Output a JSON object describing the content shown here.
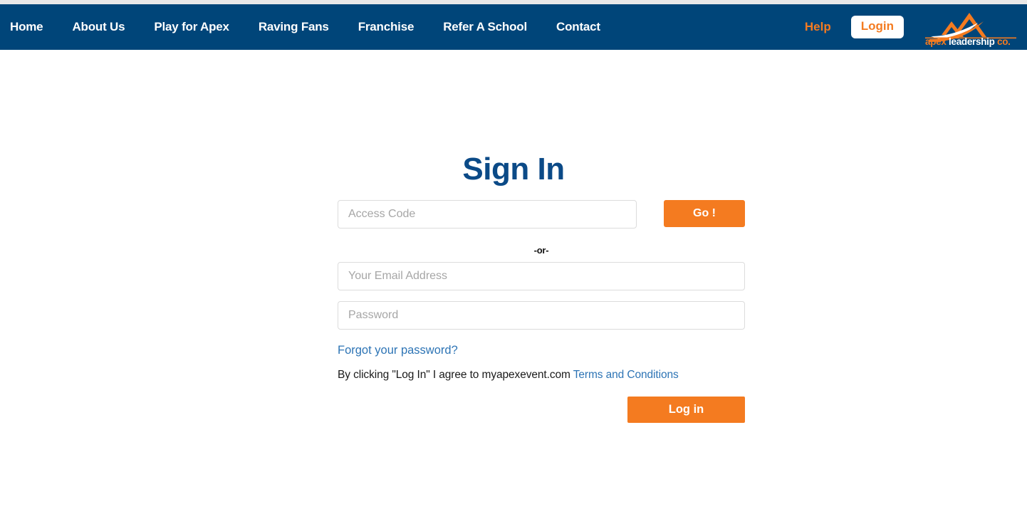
{
  "brand": {
    "logo_text_part1": "apex ",
    "logo_text_part2": "leadership ",
    "logo_text_part3": "co.",
    "navy": "#004579",
    "orange": "#f47b20",
    "link_blue": "#2d74b5",
    "heading_blue": "#0b4a87"
  },
  "nav": {
    "items": [
      {
        "label": "Home"
      },
      {
        "label": "About Us"
      },
      {
        "label": "Play for Apex"
      },
      {
        "label": "Raving Fans"
      },
      {
        "label": "Franchise"
      },
      {
        "label": "Refer A School"
      },
      {
        "label": "Contact"
      }
    ],
    "help_label": "Help",
    "login_label": "Login"
  },
  "page": {
    "title": "Sign In"
  },
  "form": {
    "access_code_placeholder": "Access Code",
    "access_code_value": "",
    "go_label": "Go !",
    "or_label": "-or-",
    "email_placeholder": "Your Email Address",
    "email_value": "",
    "password_placeholder": "Password",
    "password_value": "",
    "forgot_label": "Forgot your password?",
    "terms_prefix": "By clicking \"Log In\" I agree to myapexevent.com ",
    "terms_link_label": "Terms and Conditions",
    "submit_label": "Log in"
  }
}
